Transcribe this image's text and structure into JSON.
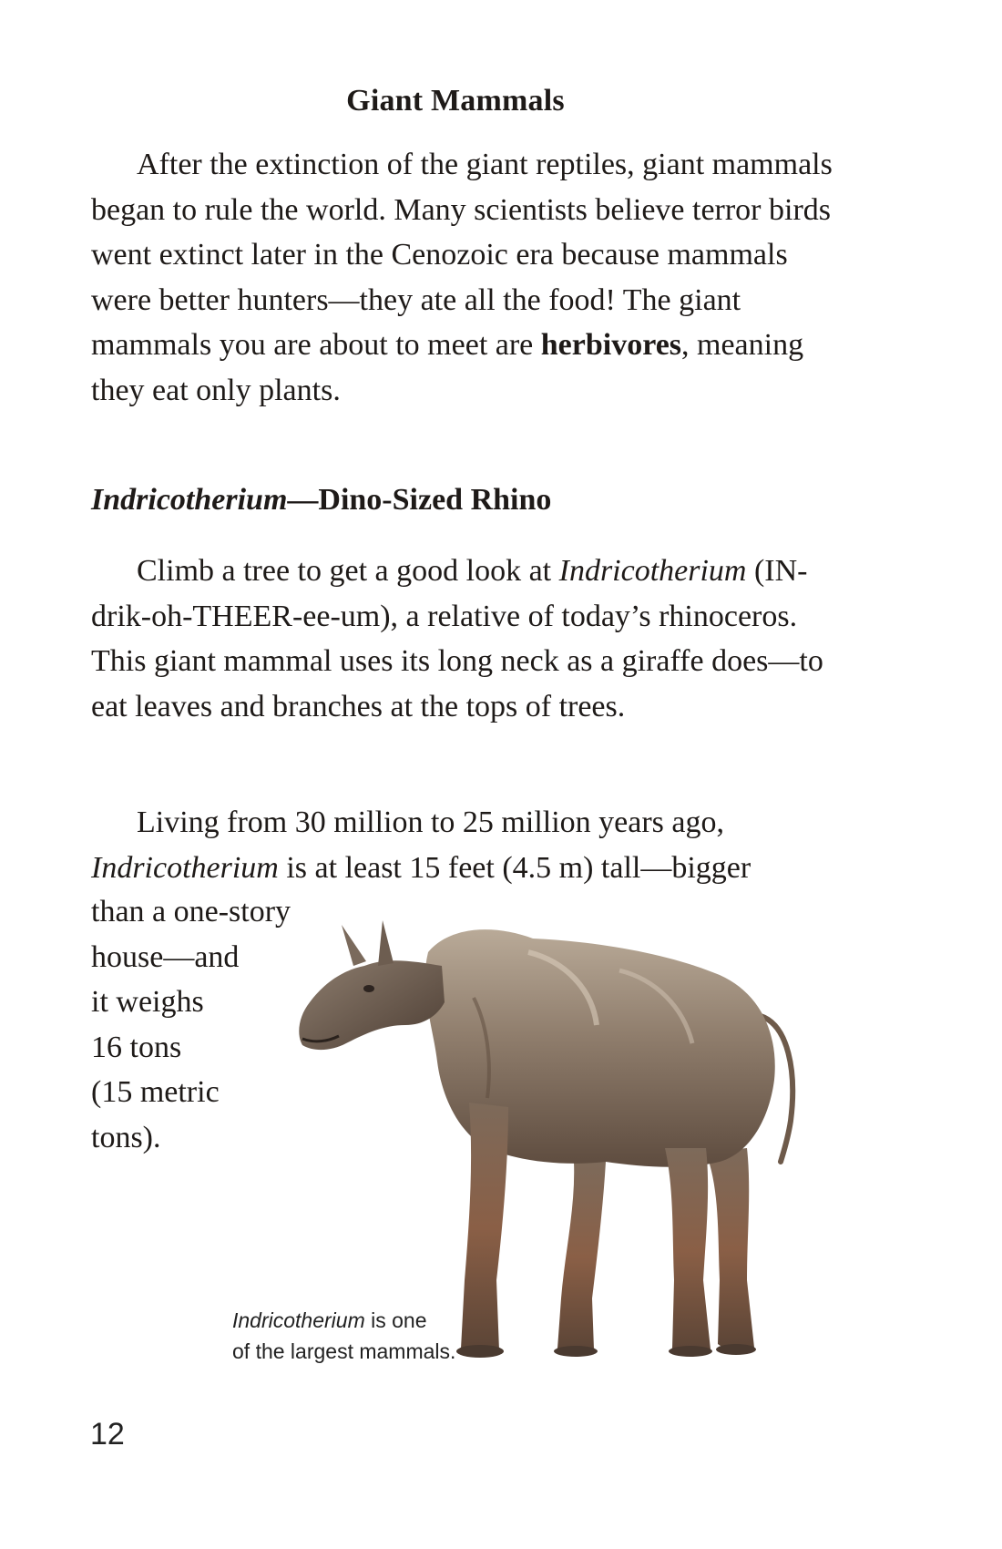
{
  "title": "Giant Mammals",
  "intro": {
    "text_before_bold": "After the extinction of the giant reptiles, giant mammals began to rule the world. Many scientists believe terror birds went extinct later in the Cenozoic era because mammals were better hunters—they ate all the food! The giant mammals you are about to meet are ",
    "bold_term": "herbivores",
    "text_after_bold": ", meaning they eat only plants."
  },
  "section": {
    "heading_italic": "Indricotherium",
    "heading_rest": "—Dino-Sized Rhino",
    "para1_before": "Climb a tree to get a good look at ",
    "para1_italic": "Indricotherium",
    "para1_after": " (IN-drik-oh-THEER-ee-um), a relative of today’s rhinoceros. This giant mammal uses its long neck as a giraffe does—to eat leaves and branches at the tops of trees.",
    "para2_line1": "Living from 30 million to 25 million years ago,",
    "para2_italic": "Indricotherium",
    "para2_line2_rest": " is at least 15 feet (4.5 m) tall—bigger",
    "wrap_lines": [
      "than a one-story",
      "house—and",
      "it weighs",
      "16 tons",
      "(15 metric",
      "tons)."
    ]
  },
  "caption": {
    "italic": "Indricotherium",
    "rest_line1": " is one",
    "line2": "of the largest mammals."
  },
  "page_number": "12",
  "image": {
    "subject": "indricotherium-illustration"
  }
}
